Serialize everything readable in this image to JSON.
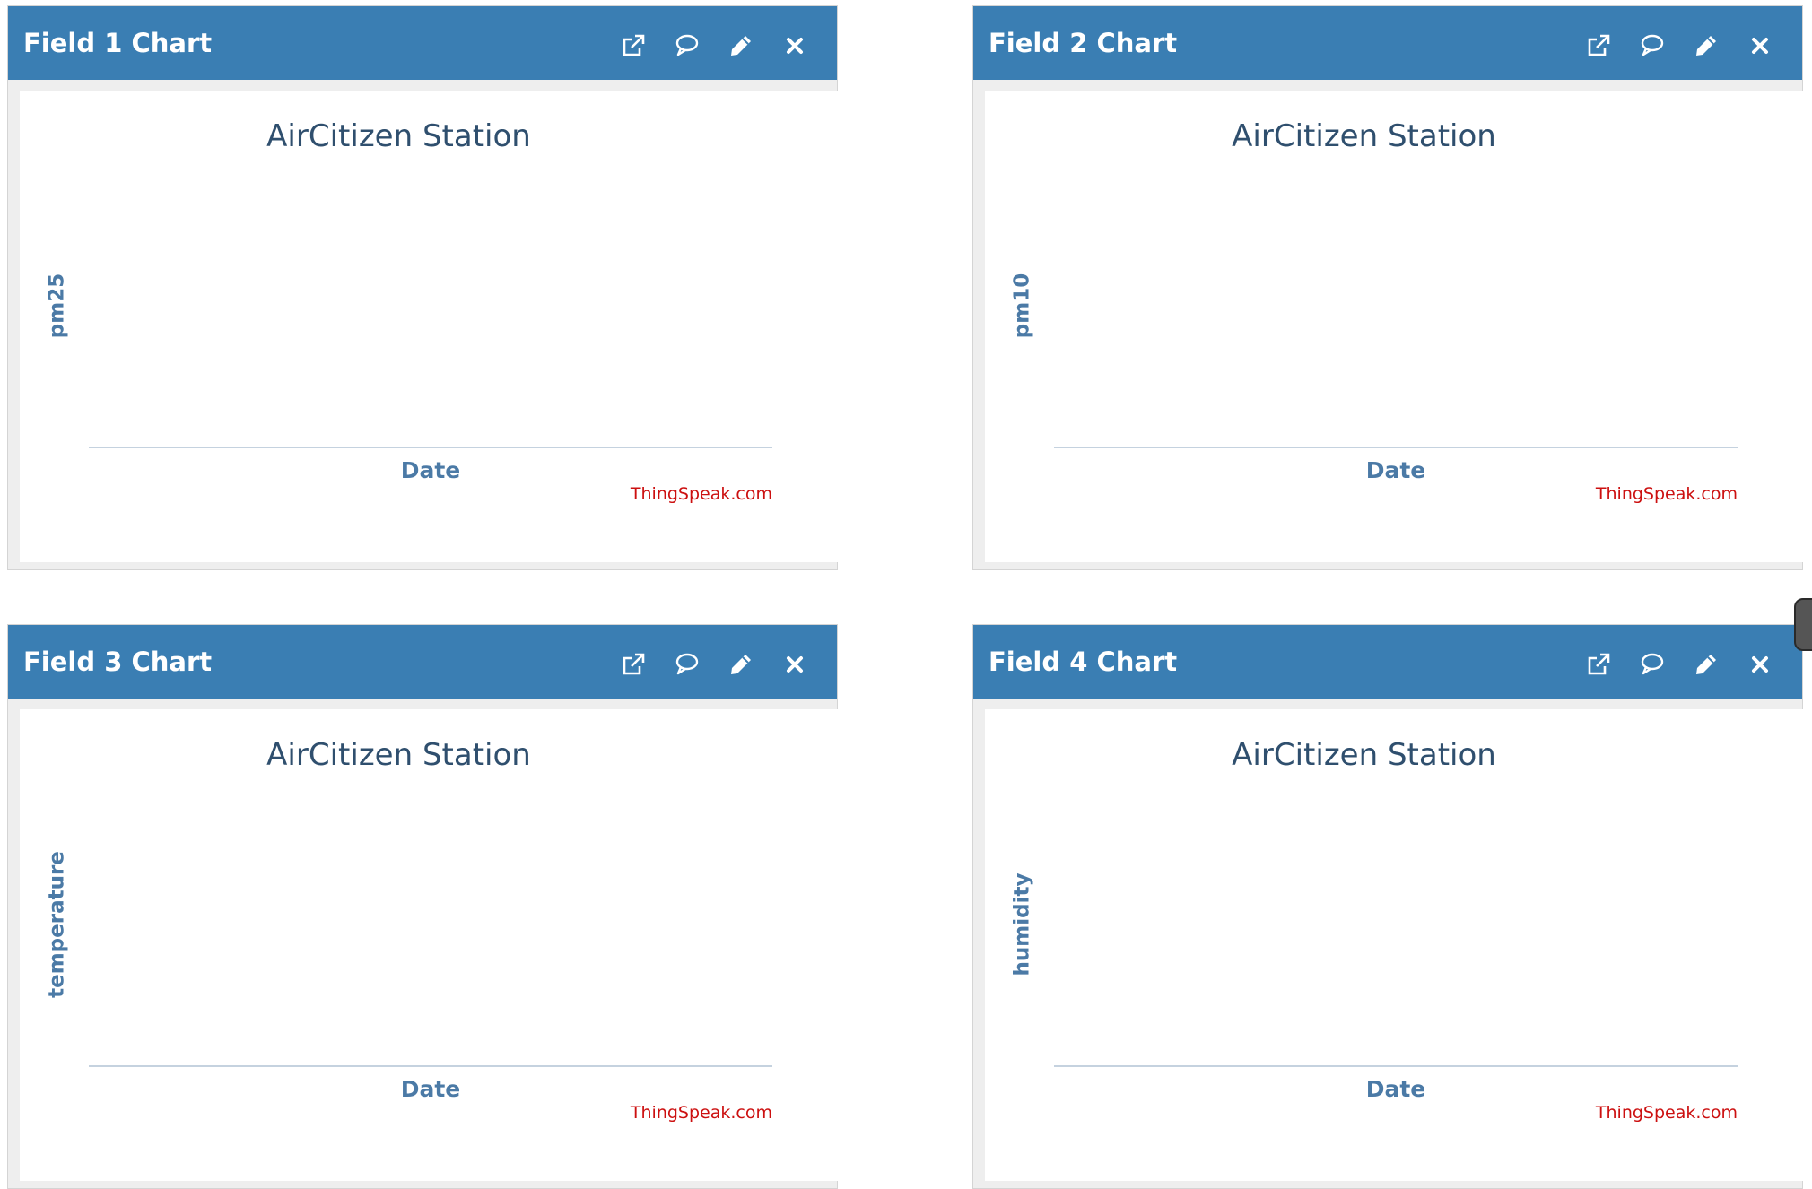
{
  "charts": [
    {
      "header_title": "Field 1 Chart",
      "chart_title": "AirCitizen Station",
      "y_label": "pm25",
      "x_label": "Date",
      "credit": "ThingSpeak.com"
    },
    {
      "header_title": "Field 2 Chart",
      "chart_title": "AirCitizen Station",
      "y_label": "pm10",
      "x_label": "Date",
      "credit": "ThingSpeak.com"
    },
    {
      "header_title": "Field 3 Chart",
      "chart_title": "AirCitizen Station",
      "y_label": "temperature",
      "x_label": "Date",
      "credit": "ThingSpeak.com"
    },
    {
      "header_title": "Field 4 Chart",
      "chart_title": "AirCitizen Station",
      "y_label": "humidity",
      "x_label": "Date",
      "credit": "ThingSpeak.com"
    }
  ],
  "header_icons": [
    "external-link-icon",
    "comment-icon",
    "pencil-icon",
    "close-icon"
  ],
  "colors": {
    "header_bg": "#3a7eb3",
    "header_text": "#ffffff",
    "chart_title": "#2f4f6e",
    "axis_label": "#4b7aa6",
    "axis_line": "#c5d2df",
    "credit": "#cc1010",
    "card_bg": "#eeeeee"
  }
}
